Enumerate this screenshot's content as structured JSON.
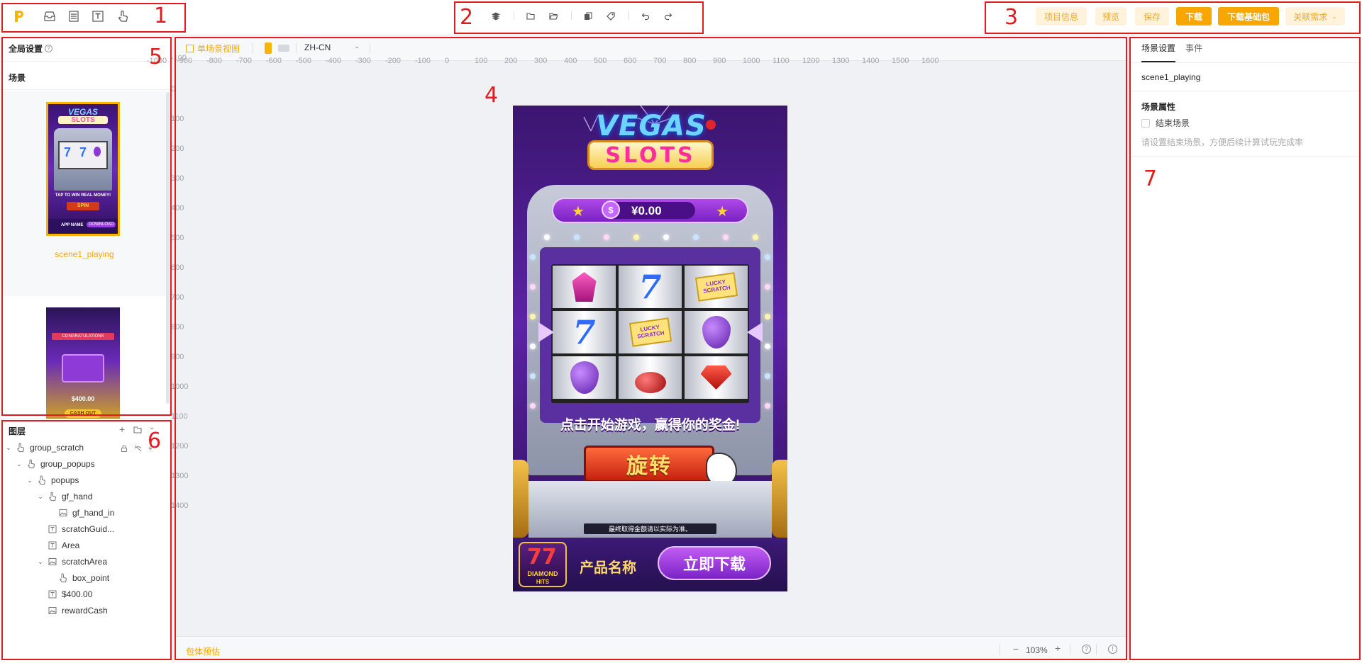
{
  "annotations": [
    "1",
    "2",
    "3",
    "4",
    "5",
    "6",
    "7"
  ],
  "topbar": {
    "logo_icon": "p-logo-icon",
    "left_icons": [
      "inbox-icon",
      "form-icon",
      "text-icon",
      "hand-pointer-icon"
    ],
    "tool_icons": [
      "layers-icon",
      "folder-icon",
      "folder-open-icon",
      "copy-icon",
      "tag-icon",
      "undo-icon",
      "redo-icon"
    ],
    "buttons": {
      "project_info": "项目信息",
      "preview": "预览",
      "save": "保存",
      "download": "下载",
      "download_base": "下载基础包",
      "related": "关联需求"
    }
  },
  "scene_panel": {
    "global_settings": "全局设置",
    "scenes_title": "场景",
    "scenes": [
      {
        "name": "scene1_playing",
        "selected": true,
        "thumb_top": "VEGAS",
        "thumb_top2": "SLOTS",
        "thumb_cta": "TAP TO WIN REAL MONEY!",
        "thumb_btn": "SPIN",
        "thumb_app": "APP NAME",
        "thumb_dl": "DOWNLOAD"
      },
      {
        "name": "",
        "selected": false,
        "thumb_top": "CONGRATULATIONS",
        "thumb_amount": "$400.00",
        "thumb_btn": "CASH OUT"
      }
    ]
  },
  "layer_panel": {
    "title": "图层",
    "layers": [
      {
        "name": "group_scratch",
        "depth": 0,
        "icon": "hand-icon",
        "expanded": true
      },
      {
        "name": "group_popups",
        "depth": 1,
        "icon": "hand-icon",
        "expanded": true
      },
      {
        "name": "popups",
        "depth": 2,
        "icon": "hand-icon",
        "expanded": true
      },
      {
        "name": "gf_hand",
        "depth": 3,
        "icon": "hand-icon",
        "expanded": true
      },
      {
        "name": "gf_hand_in",
        "depth": 4,
        "icon": "image-icon",
        "expanded": null
      },
      {
        "name": "scratchGuid...",
        "depth": 3,
        "icon": "text-icon",
        "expanded": null
      },
      {
        "name": "Area",
        "depth": 3,
        "icon": "text-icon",
        "expanded": null
      },
      {
        "name": "scratchArea",
        "depth": 3,
        "icon": "image-icon",
        "expanded": true
      },
      {
        "name": "box_point",
        "depth": 4,
        "icon": "hand-icon",
        "expanded": null
      },
      {
        "name": "$400.00",
        "depth": 3,
        "icon": "text-icon",
        "expanded": null
      },
      {
        "name": "rewardCash",
        "depth": 3,
        "icon": "image-icon",
        "expanded": null
      }
    ]
  },
  "canvas": {
    "view_mode": "单场景视图",
    "language": "ZH-CN",
    "ruler_x": [
      "-1000",
      "-900",
      "-800",
      "-700",
      "-600",
      "-500",
      "-400",
      "-300",
      "-200",
      "-100",
      "0",
      "100",
      "200",
      "300",
      "400",
      "500",
      "600",
      "700",
      "800",
      "900",
      "1000",
      "1100",
      "1200",
      "1300",
      "1400",
      "1500",
      "1600"
    ],
    "ruler_y": [
      "-100",
      "0",
      "100",
      "200",
      "300",
      "400",
      "500",
      "600",
      "700",
      "800",
      "900",
      "1000",
      "1100",
      "1200",
      "1300",
      "1400"
    ],
    "package_estimate": "包体预估",
    "zoom": "103%"
  },
  "ad": {
    "title_line1": "VEGAS",
    "title_line2": "SLOTS",
    "balance": "¥0.00",
    "cta_text": "点击开始游戏，赢得你的奖金!",
    "spin_label": "旋转",
    "disclaimer": "最终取得金额请以实际为准。",
    "product_name": "产品名称",
    "download_label": "立即下载",
    "lucky": "LUCKY",
    "scratch": "SCRATCH",
    "brand1": "DIAMOND",
    "brand2": "HITS"
  },
  "right_panel": {
    "tabs": [
      "场景设置",
      "事件"
    ],
    "scene_name": "scene1_playing",
    "props_title": "场景属性",
    "end_scene_label": "结束场景",
    "end_scene_checked": false,
    "hint": "请设置结束场景，方便后续计算试玩完成率"
  },
  "colors": {
    "accent": "#f8a603",
    "annotation_red": "#e21c1c"
  }
}
